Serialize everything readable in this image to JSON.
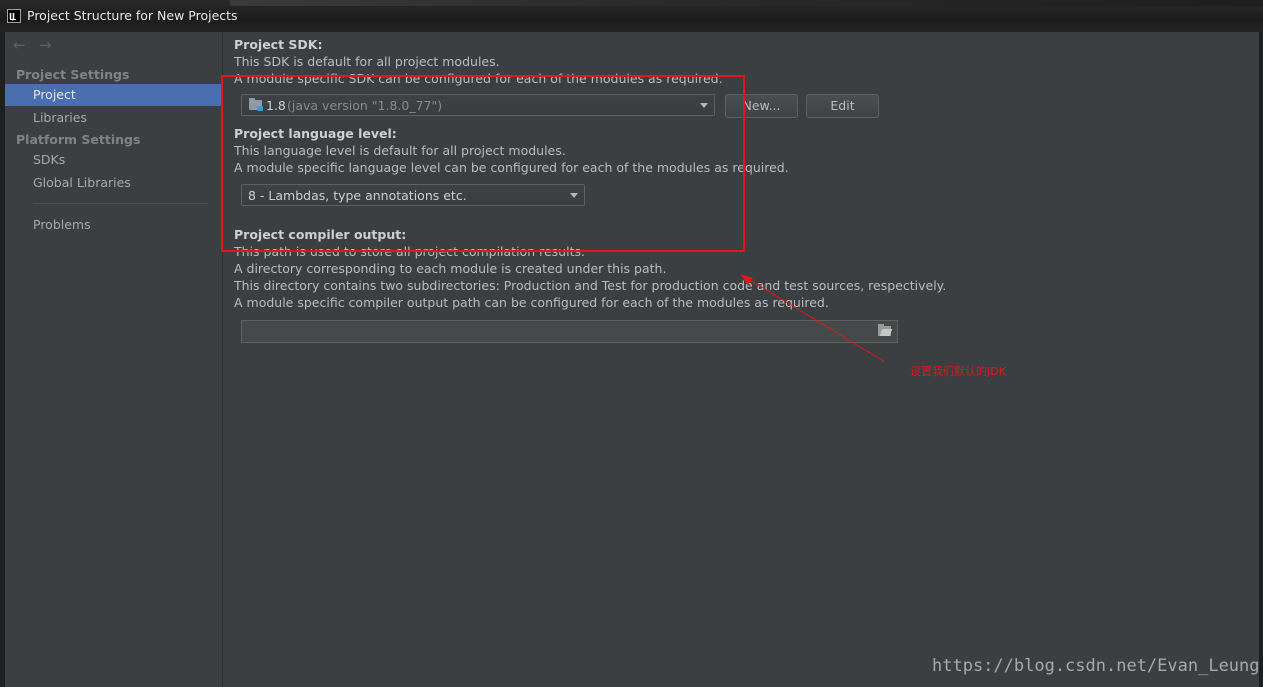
{
  "window": {
    "title": "Project Structure for New Projects"
  },
  "sidebar": {
    "nav_back": "←",
    "nav_forward": "→",
    "project_settings_header": "Project Settings",
    "project_settings_items": [
      "Project",
      "Libraries"
    ],
    "platform_settings_header": "Platform Settings",
    "platform_settings_items": [
      "SDKs",
      "Global Libraries"
    ],
    "problems": "Problems",
    "selected": "Project"
  },
  "sdk": {
    "heading": "Project SDK:",
    "line1": "This SDK is default for all project modules.",
    "line2": "A module specific SDK can be configured for each of the modules as required.",
    "selected_version": "1.8",
    "selected_detail": "(java version \"1.8.0_77\")",
    "new_button": "New...",
    "edit_button": "Edit"
  },
  "language": {
    "heading": "Project language level:",
    "line1": "This language level is default for all project modules.",
    "line2": "A module specific language level can be configured for each of the modules as required.",
    "selected": "8 - Lambdas, type annotations etc."
  },
  "compiler": {
    "heading": "Project compiler output:",
    "line1": "This path is used to store all project compilation results.",
    "line2": "A directory corresponding to each module is created under this path.",
    "line3": "This directory contains two subdirectories: Production and Test for production code and test sources, respectively.",
    "line4": "A module specific compiler output path can be configured for each of the modules as required.",
    "output_path": ""
  },
  "annotation": {
    "text": "设置我们默认的JDK"
  },
  "watermark": "https://blog.csdn.net/Evan_Leung",
  "colors": {
    "selection": "#4b6eaf",
    "annotation_red": "#e0171c",
    "background": "#3c3f41"
  }
}
